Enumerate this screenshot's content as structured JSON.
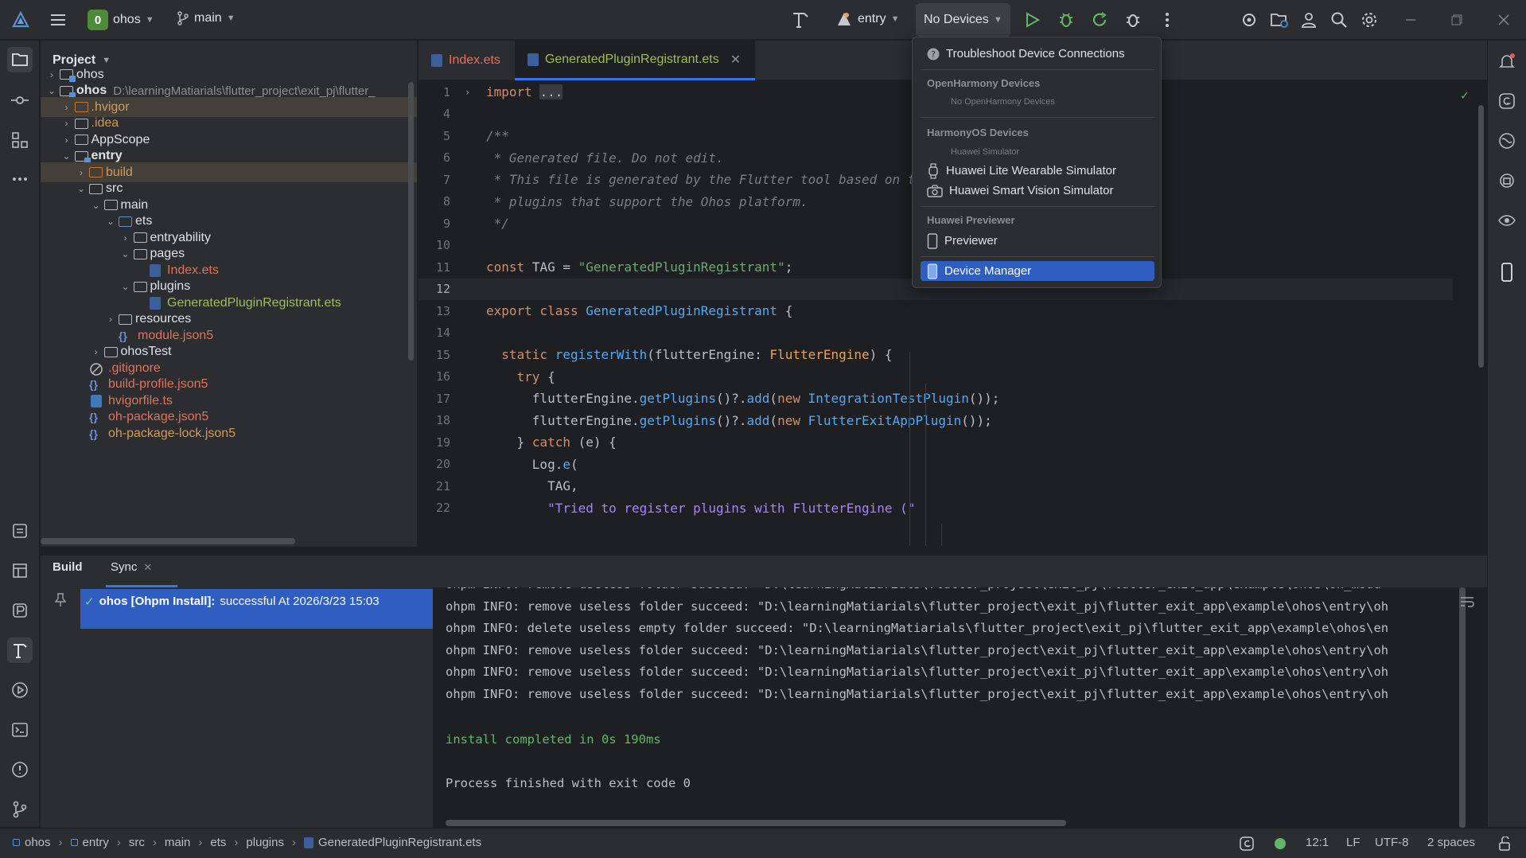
{
  "titlebar": {
    "project_badge": "0",
    "project_name": "ohos",
    "branch": "main",
    "run_config": "entry",
    "device_selector": "No Devices"
  },
  "project_panel": {
    "title": "Project",
    "tree": [
      {
        "label": "ohos",
        "extra": "",
        "depth": 0,
        "arrow": "▶",
        "icon": "module-icon",
        "color": "normal"
      },
      {
        "label": "ohos",
        "extra": "D:\\learningMatiarials\\flutter_project\\exit_pj\\flutter_",
        "depth": 0,
        "arrow": "▼",
        "icon": "module-icon",
        "color": "bold"
      },
      {
        "label": ".hvigor",
        "extra": "",
        "depth": 1,
        "arrow": "▶",
        "icon": "folder-orange",
        "color": "orange"
      },
      {
        "label": ".idea",
        "extra": "",
        "depth": 1,
        "arrow": "▶",
        "icon": "folder",
        "color": "orange"
      },
      {
        "label": "AppScope",
        "extra": "",
        "depth": 1,
        "arrow": "▶",
        "icon": "folder",
        "color": "normal"
      },
      {
        "label": "entry",
        "extra": "",
        "depth": 1,
        "arrow": "▼",
        "icon": "module-icon",
        "color": "bold"
      },
      {
        "label": "build",
        "extra": "",
        "depth": 2,
        "arrow": "▶",
        "icon": "folder-orange",
        "color": "orange"
      },
      {
        "label": "src",
        "extra": "",
        "depth": 2,
        "arrow": "▼",
        "icon": "folder",
        "color": "normal"
      },
      {
        "label": "main",
        "extra": "",
        "depth": 3,
        "arrow": "▼",
        "icon": "folder",
        "color": "normal"
      },
      {
        "label": "ets",
        "extra": "",
        "depth": 4,
        "arrow": "▼",
        "icon": "folder-blue",
        "color": "normal"
      },
      {
        "label": "entryability",
        "extra": "",
        "depth": 5,
        "arrow": "▶",
        "icon": "folder",
        "color": "normal"
      },
      {
        "label": "pages",
        "extra": "",
        "depth": 5,
        "arrow": "▼",
        "icon": "folder",
        "color": "normal"
      },
      {
        "label": "Index.ets",
        "extra": "",
        "depth": 6,
        "arrow": "",
        "icon": "ets-file",
        "color": "red"
      },
      {
        "label": "plugins",
        "extra": "",
        "depth": 5,
        "arrow": "▼",
        "icon": "folder",
        "color": "normal"
      },
      {
        "label": "GeneratedPluginRegistrant.ets",
        "extra": "",
        "depth": 6,
        "arrow": "",
        "icon": "ets-file",
        "color": "green"
      },
      {
        "label": "resources",
        "extra": "",
        "depth": 4,
        "arrow": "▶",
        "icon": "folder",
        "color": "normal"
      },
      {
        "label": "module.json5",
        "extra": "",
        "depth": 4,
        "arrow": "",
        "icon": "json-file",
        "color": "red"
      },
      {
        "label": "ohosTest",
        "extra": "",
        "depth": 3,
        "arrow": "▶",
        "icon": "folder",
        "color": "normal"
      },
      {
        "label": ".gitignore",
        "extra": "",
        "depth": 2,
        "arrow": "",
        "icon": "ignore-file",
        "color": "red"
      },
      {
        "label": "build-profile.json5",
        "extra": "",
        "depth": 2,
        "arrow": "",
        "icon": "json-file",
        "color": "red"
      },
      {
        "label": "hvigorfile.ts",
        "extra": "",
        "depth": 2,
        "arrow": "",
        "icon": "ts-file",
        "color": "red"
      },
      {
        "label": "oh-package.json5",
        "extra": "",
        "depth": 2,
        "arrow": "",
        "icon": "json-file",
        "color": "red"
      },
      {
        "label": "oh-package-lock.json5",
        "extra": "",
        "depth": 2,
        "arrow": "",
        "icon": "json-file",
        "color": "orange"
      }
    ]
  },
  "editor_tabs": [
    {
      "label": "Index.ets",
      "active": false
    },
    {
      "label": "GeneratedPluginRegistrant.ets",
      "active": true
    }
  ],
  "editor": {
    "lines": [
      {
        "n": "1",
        "html": "<span class='kw'>import</span> <span class='pl' style='background:#393b40'>...</span>"
      },
      {
        "n": "4",
        "html": ""
      },
      {
        "n": "5",
        "html": "<span class='cmt'>/**</span>"
      },
      {
        "n": "6",
        "html": "<span class='cmt'> * Generated file. Do not edit.</span>"
      },
      {
        "n": "7",
        "html": "<span class='cmt'> * This file is generated by the Flutter tool based on the</span>"
      },
      {
        "n": "8",
        "html": "<span class='cmt'> * plugins that support the Ohos platform.</span>"
      },
      {
        "n": "9",
        "html": "<span class='cmt'> */</span>"
      },
      {
        "n": "10",
        "html": ""
      },
      {
        "n": "11",
        "html": "<span class='kw'>const</span> <span class='pl'>TAG = </span><span class='str'>\"GeneratedPluginRegistrant\"</span><span class='pl'>;</span>"
      },
      {
        "n": "12",
        "html": ""
      },
      {
        "n": "13",
        "html": "<span class='kw'>export class</span> <span class='cls'>GeneratedPluginRegistrant</span> <span class='pl'>{</span>"
      },
      {
        "n": "14",
        "html": ""
      },
      {
        "n": "15",
        "html": "  <span class='kw'>static</span> <span class='fn'>registerWith</span><span class='pl'>(flutterEngine: </span><span class='typ'>FlutterEngine</span><span class='pl'>) {</span>"
      },
      {
        "n": "16",
        "html": "    <span class='kw'>try</span> <span class='pl'>{</span>"
      },
      {
        "n": "17",
        "html": "      <span class='pl'>flutterEngine.</span><span class='fn'>getPlugins</span><span class='pl'>()?.</span><span class='fn'>add</span><span class='pl'>(</span><span class='kw'>new</span> <span class='cls'>IntegrationTestPlugin</span><span class='pl'>());</span>"
      },
      {
        "n": "18",
        "html": "      <span class='pl'>flutterEngine.</span><span class='fn'>getPlugins</span><span class='pl'>()?.</span><span class='fn'>add</span><span class='pl'>(</span><span class='kw'>new</span> <span class='cls'>FlutterExitAppPlugin</span><span class='pl'>());</span>"
      },
      {
        "n": "19",
        "html": "    <span class='pl'>}</span> <span class='kw'>catch</span> <span class='pl'>(e) {</span>"
      },
      {
        "n": "20",
        "html": "      <span class='pl'>Log.</span><span class='fn'>e</span><span class='pl'>(</span>"
      },
      {
        "n": "21",
        "html": "        <span class='pl'>TAG,</span>"
      },
      {
        "n": "22",
        "html": "        <span class='strv'>\"Tried to register plugins with FlutterEngine (\"</span>"
      }
    ],
    "current_line": "12"
  },
  "device_dropdown": {
    "troubleshoot": "Troubleshoot Device Connections",
    "openharmony_header": "OpenHarmony Devices",
    "openharmony_empty": "No OpenHarmony Devices",
    "harmonyos_header": "HarmonyOS Devices",
    "harmonyos_sub": "Huawei Simulator",
    "sim1": "Huawei Lite Wearable Simulator",
    "sim2": "Huawei Smart Vision Simulator",
    "previewer_header": "Huawei Previewer",
    "previewer": "Previewer",
    "device_manager": "Device Manager"
  },
  "bottom_panel": {
    "tab_build": "Build",
    "tab_sync": "Sync",
    "build_item_bold": "ohos [Ohpm Install]:",
    "build_item_rest": "successful At 2026/3/23 15:03",
    "console": [
      "ohpm INFO: remove useless folder succeed: \"D:\\learningMatiarials\\flutter_project\\exit_pj\\flutter_exit_app\\example\\ohos\\oh_modu",
      "ohpm INFO: remove useless folder succeed: \"D:\\learningMatiarials\\flutter_project\\exit_pj\\flutter_exit_app\\example\\ohos\\entry\\oh",
      "ohpm INFO: delete useless empty folder succeed: \"D:\\learningMatiarials\\flutter_project\\exit_pj\\flutter_exit_app\\example\\ohos\\en",
      "ohpm INFO: remove useless folder succeed: \"D:\\learningMatiarials\\flutter_project\\exit_pj\\flutter_exit_app\\example\\ohos\\entry\\oh",
      "ohpm INFO: remove useless folder succeed: \"D:\\learningMatiarials\\flutter_project\\exit_pj\\flutter_exit_app\\example\\ohos\\entry\\oh",
      "ohpm INFO: remove useless folder succeed: \"D:\\learningMatiarials\\flutter_project\\exit_pj\\flutter_exit_app\\example\\ohos\\entry\\oh"
    ],
    "install_done": "install completed in 0s 190ms",
    "process_done": "Process finished with exit code 0"
  },
  "statusbar": {
    "breadcrumbs": [
      "ohos",
      "entry",
      "src",
      "main",
      "ets",
      "plugins",
      "GeneratedPluginRegistrant.ets"
    ],
    "position": "12:1",
    "line_sep": "LF",
    "encoding": "UTF-8",
    "indent": "2 spaces"
  },
  "colors": {
    "accent": "#3574f0",
    "selection": "#2f5ec0",
    "success": "#5fb865"
  }
}
